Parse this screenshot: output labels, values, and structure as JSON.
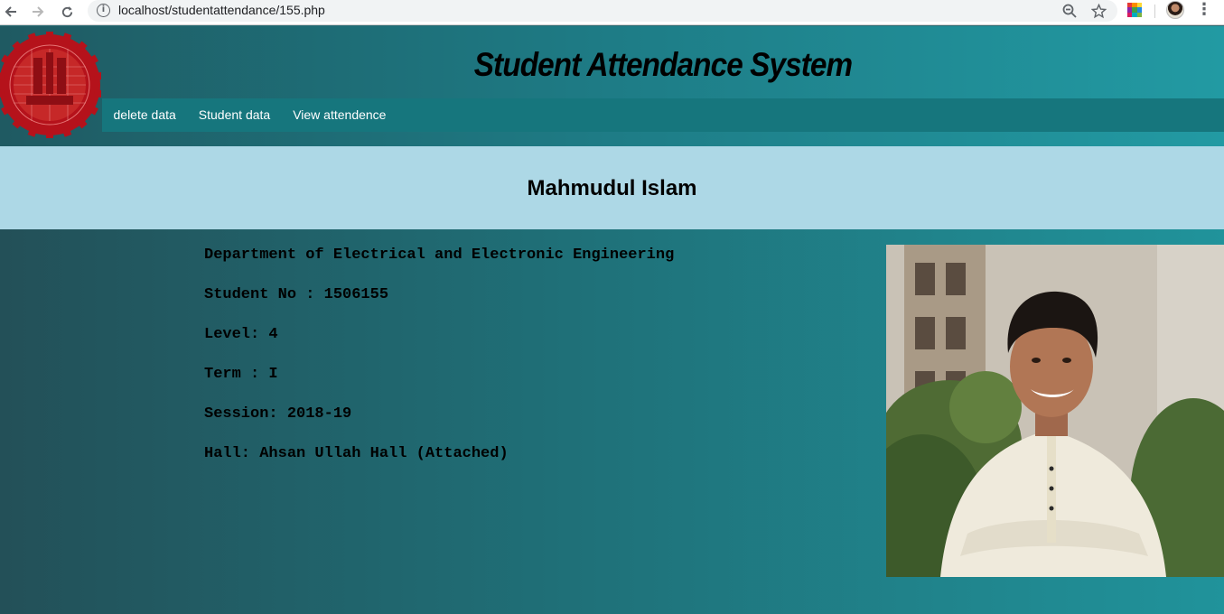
{
  "browser": {
    "url": "localhost/studentattendance/155.php",
    "back_icon": "arrow-left-icon",
    "forward_icon": "arrow-right-icon",
    "reload_icon": "reload-icon",
    "info_icon": "info-icon",
    "info_glyph": "i",
    "zoom_icon": "zoom-out-icon",
    "bookmark_icon": "star-icon",
    "extension_icon": "extension-icon",
    "menu_icon": "vertical-dots-icon"
  },
  "header": {
    "title": "Student Attendance System",
    "logo": "university-seal-logo",
    "nav": [
      {
        "label": "delete data"
      },
      {
        "label": "Student data"
      },
      {
        "label": "View attendence"
      }
    ]
  },
  "student": {
    "name": "Mahmudul Islam",
    "department": "Department of Electrical and Electronic Engineering",
    "student_no": "Student No : 1506155",
    "level": "Level: 4",
    "term": "Term : I",
    "session": "Session: 2018-19",
    "hall": "Hall: Ahsan Ullah Hall (Attached)",
    "photo": "student-portrait-photo"
  },
  "colors": {
    "header_start": "#1f5a62",
    "header_end": "#229aa3",
    "navbar": "#16767d",
    "name_band": "#add8e6",
    "logo_red": "#b5121b"
  }
}
